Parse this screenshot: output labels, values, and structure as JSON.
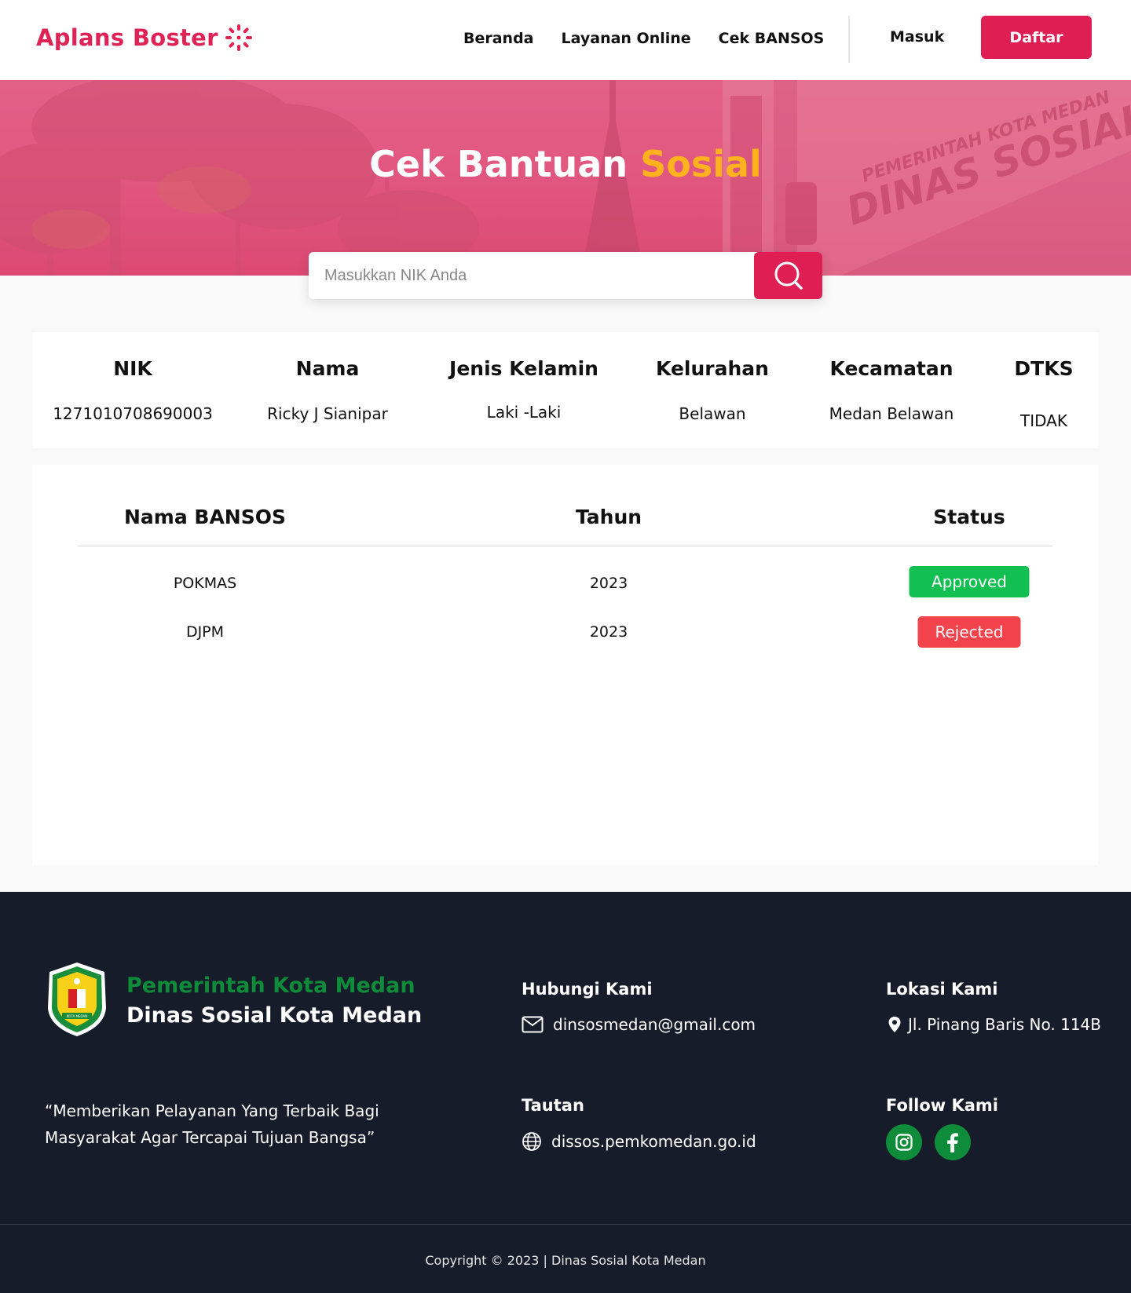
{
  "header": {
    "logo_text": "Aplans Boster",
    "nav": [
      "Beranda",
      "Layanan Online",
      "Cek BANSOS"
    ],
    "login_label": "Masuk",
    "register_label": "Daftar"
  },
  "hero": {
    "title_main": "Cek Bantuan",
    "title_accent": "Sosial",
    "sign_line1": "PEMERINTAH KOTA MEDAN",
    "sign_line2": "DINAS SOSIAL"
  },
  "search": {
    "placeholder": "Masukkan NIK Anda",
    "value": ""
  },
  "person": {
    "headers": [
      "NIK",
      "Nama",
      "Jenis Kelamin",
      "Kelurahan",
      "Kecamatan",
      "DTKS"
    ],
    "values": [
      "1271010708690003",
      "Ricky J Sianipar",
      "Laki -Laki",
      "Belawan",
      "Medan Belawan",
      "TIDAK"
    ]
  },
  "bansos": {
    "headers": [
      "Nama BANSOS",
      "Tahun",
      "Status"
    ],
    "rows": [
      {
        "name": "POKMAS",
        "year": "2023",
        "status": "Approved"
      },
      {
        "name": "DJPM",
        "year": "2023",
        "status": "Rejected"
      }
    ]
  },
  "footer": {
    "org_line1": "Pemerintah Kota Medan",
    "org_line2": "Dinas Sosial Kota Medan",
    "emblem_caption": "KOTA MEDAN",
    "quote": "“Memberikan Pelayanan Yang Terbaik Bagi Masyarakat Agar Tercapai Tujuan Bangsa”",
    "contact_heading": "Hubungi Kami",
    "email": "dinsosmedan@gmail.com",
    "location_heading": "Lokasi Kami",
    "address": "Jl. Pinang Baris No. 114B",
    "links_heading": "Tautan",
    "website": "dissos.pemkomedan.go.id",
    "follow_heading": "Follow Kami",
    "copyright": "Copyright © 2023 | Dinas Sosial Kota Medan"
  },
  "colors": {
    "brand": "#df1f53",
    "accent": "#ffb21e",
    "approved": "#12c052",
    "rejected": "#f2424b",
    "footer_bg": "#161c29",
    "footer_green": "#0f8c3a"
  },
  "icons": [
    "flower-logo-icon",
    "search-icon",
    "mail-icon",
    "globe-icon",
    "location-pin-icon",
    "instagram-icon",
    "facebook-icon"
  ]
}
